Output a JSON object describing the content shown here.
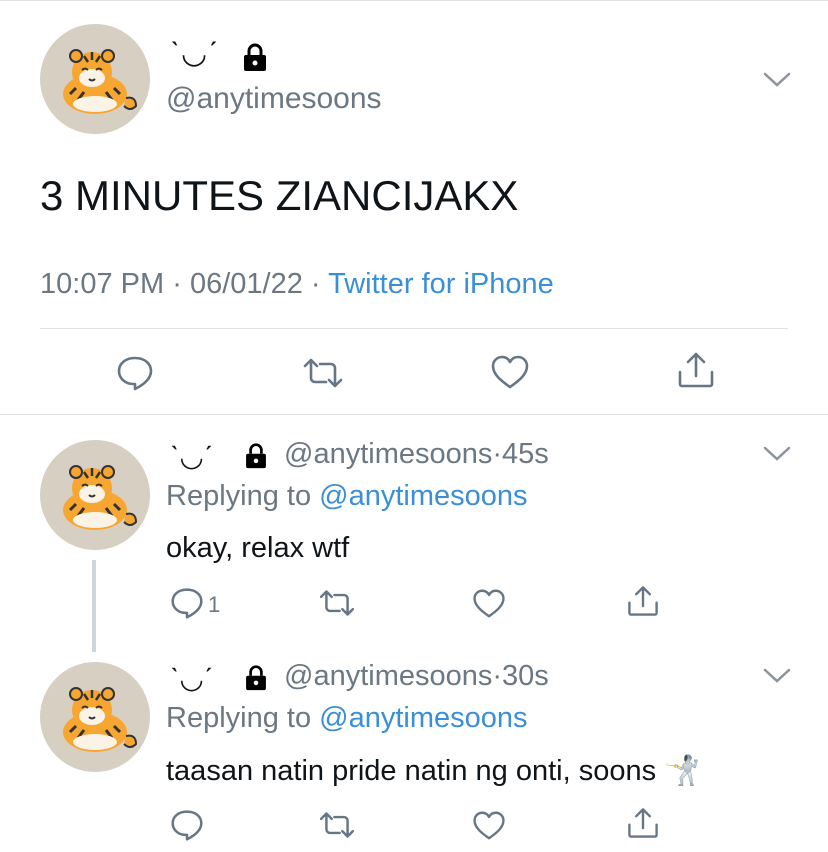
{
  "main_tweet": {
    "display_name": "ˋ◡ˊ",
    "handle": "@anytimesoons",
    "text": "3 MINUTES ZIANCIJAKX",
    "time": "10:07 PM",
    "date": "06/01/22",
    "source": "Twitter for iPhone",
    "separator": "·"
  },
  "replies": [
    {
      "display_name": "ˋ◡ˊ",
      "handle": "@anytimesoons",
      "age": "45s",
      "replying_label": "Replying to",
      "replying_handle": "@anytimesoons",
      "text": "okay, relax wtf",
      "reply_count": "1",
      "emoji": ""
    },
    {
      "display_name": "ˋ◡ˊ",
      "handle": "@anytimesoons",
      "age": "30s",
      "replying_label": "Replying to",
      "replying_handle": "@anytimesoons",
      "text": "taasan natin pride natin ng onti, soons",
      "reply_count": "",
      "emoji": "🤺"
    }
  ],
  "icons": {
    "avatar": "tiger-avatar",
    "lock": "lock-icon",
    "chevron": "chevron-down-icon",
    "reply": "reply-icon",
    "retweet": "retweet-icon",
    "like": "heart-icon",
    "share": "share-icon"
  },
  "colors": {
    "link": "#3a8fd9",
    "muted": "#6b7782",
    "text": "#0f1419",
    "divider": "#dfe3e6"
  }
}
